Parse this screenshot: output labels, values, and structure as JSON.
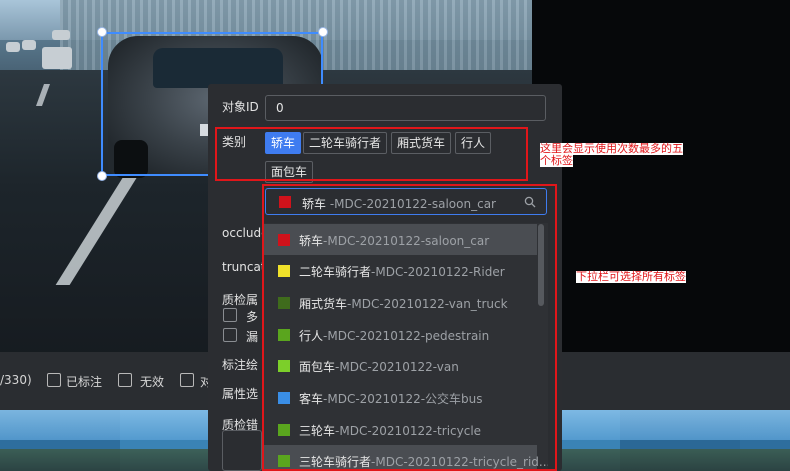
{
  "form": {
    "object_id_label": "对象ID",
    "object_id_value": "0",
    "category_label": "类别",
    "category_tags": [
      "轿车",
      "二轮车骑行者",
      "厢式货车",
      "行人",
      "面包车"
    ],
    "selected_category": {
      "name": "轿车",
      "code": " -MDC-20210122-saloon_car",
      "color": "#d0121b"
    },
    "partial_labels": [
      "occlude",
      "truncate",
      "质检属",
      "多",
      "漏",
      "标注绘",
      "属性选",
      "质检错"
    ]
  },
  "dropdown_items": [
    {
      "name": "轿车",
      "code": "-MDC-20210122-saloon_car",
      "color": "#d0121b"
    },
    {
      "name": "二轮车骑行者",
      "code": "-MDC-20210122-Rider",
      "color": "#f0e12a"
    },
    {
      "name": "厢式货车",
      "code": "-MDC-20210122-van_truck",
      "color": "#3f6b1c"
    },
    {
      "name": "行人",
      "code": "-MDC-20210122-pedestrain",
      "color": "#5aa51e"
    },
    {
      "name": "面包车",
      "code": "-MDC-20210122-van",
      "color": "#7ccf2a"
    },
    {
      "name": "客车",
      "code": "-MDC-20210122-公交车bus",
      "color": "#3a8ee6"
    },
    {
      "name": "三轮车",
      "code": "-MDC-20210122-tricycle",
      "color": "#5aa51e"
    },
    {
      "name": "三轮车骑行者",
      "code": "-MDC-20210122-tricycle_rid...",
      "color": "#5aa51e"
    }
  ],
  "toolbar": {
    "counter": "/330)",
    "labeled": "已标注",
    "invalid": "无效",
    "partial": "对"
  },
  "annotations": {
    "note1": "这里会显示使用次数最多的五",
    "note1b": "个标签",
    "note2": "下拉栏可选择所有标签"
  },
  "colors": {
    "accent": "#3f7cf0",
    "panel_bg": "#2b2d31",
    "callout_red": "#e0161a"
  }
}
